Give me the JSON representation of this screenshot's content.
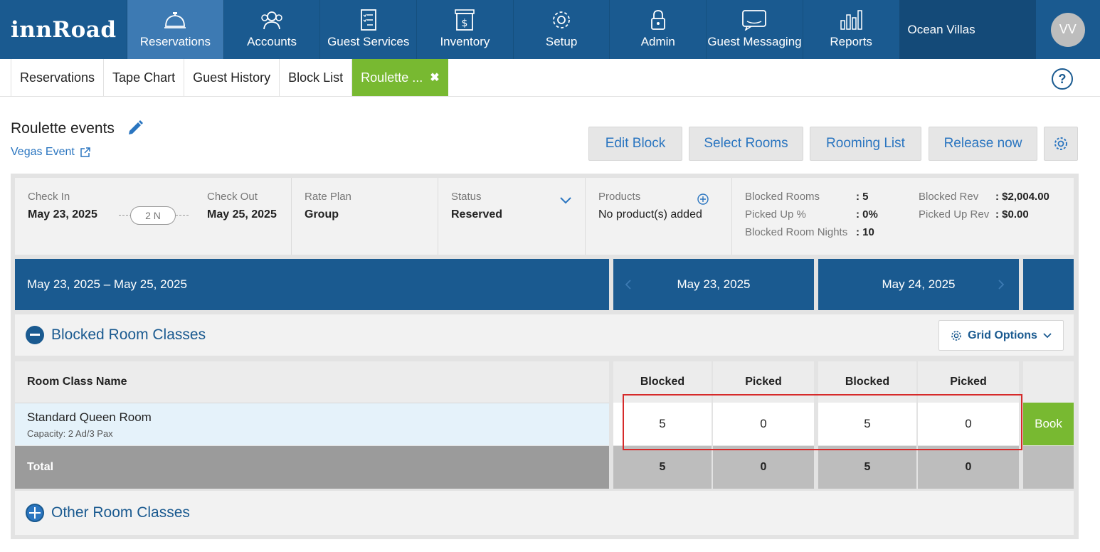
{
  "nav": {
    "logo": "innRoad",
    "items": [
      {
        "label": "Reservations",
        "icon": "bell-icon",
        "active": true
      },
      {
        "label": "Accounts",
        "icon": "users-icon",
        "active": false
      },
      {
        "label": "Guest Services",
        "icon": "checklist-icon",
        "active": false
      },
      {
        "label": "Inventory",
        "icon": "dollar-box-icon",
        "active": false
      },
      {
        "label": "Setup",
        "icon": "gear-icon",
        "active": false
      },
      {
        "label": "Admin",
        "icon": "lock-icon",
        "active": false
      },
      {
        "label": "Guest Messaging",
        "icon": "message-icon",
        "active": false
      },
      {
        "label": "Reports",
        "icon": "bar-chart-icon",
        "active": false
      }
    ],
    "property": "Ocean Villas",
    "avatar": "VV"
  },
  "subtabs": [
    {
      "label": "Reservations"
    },
    {
      "label": "Tape Chart"
    },
    {
      "label": "Guest History"
    },
    {
      "label": "Block List"
    },
    {
      "label": "Roulette ...",
      "close": "✖"
    }
  ],
  "help": "?",
  "header": {
    "title": "Roulette events",
    "link": "Vegas Event"
  },
  "actions": {
    "edit_block": "Edit Block",
    "select_rooms": "Select Rooms",
    "rooming_list": "Rooming List",
    "release_now": "Release now"
  },
  "info": {
    "check_in_label": "Check In",
    "check_in": "May 23, 2025",
    "nights": "2 N",
    "check_out_label": "Check Out",
    "check_out": "May 25, 2025",
    "rate_plan_label": "Rate Plan",
    "rate_plan": "Group",
    "status_label": "Status",
    "status": "Reserved",
    "products_label": "Products",
    "products": "No product(s) added",
    "stats": {
      "blocked_rooms_label": "Blocked Rooms",
      "blocked_rooms": ": 5",
      "picked_up_pct_label": "Picked Up %",
      "picked_up_pct": ": 0%",
      "blocked_room_nights_label": "Blocked Room Nights",
      "blocked_room_nights": ": 10",
      "blocked_rev_label": "Blocked Rev",
      "blocked_rev": ": $2,004.00",
      "picked_up_rev_label": "Picked Up Rev",
      "picked_up_rev": ": $0.00"
    }
  },
  "dates": {
    "range": "May 23, 2025 – May 25, 2025",
    "day1": "May 23, 2025",
    "day2": "May 24, 2025"
  },
  "blocked_section": {
    "title": "Blocked Room Classes",
    "grid_options": "Grid Options"
  },
  "table": {
    "col_room_class": "Room Class Name",
    "col_blocked": "Blocked",
    "col_picked": "Picked",
    "row": {
      "name": "Standard Queen Room",
      "capacity": "Capacity: 2 Ad/3 Pax",
      "d1_blocked": "5",
      "d1_picked": "0",
      "d2_blocked": "5",
      "d2_picked": "0",
      "book": "Book"
    },
    "total": {
      "label": "Total",
      "d1_blocked": "5",
      "d1_picked": "0",
      "d2_blocked": "5",
      "d2_picked": "0"
    }
  },
  "other_section": {
    "title": "Other Room Classes"
  },
  "colors": {
    "nav_bg": "#1a5a90",
    "nav_active": "#3d7ab3",
    "tab_active": "#78b931",
    "link": "#2a75c0",
    "highlight": "#d62a2a"
  }
}
